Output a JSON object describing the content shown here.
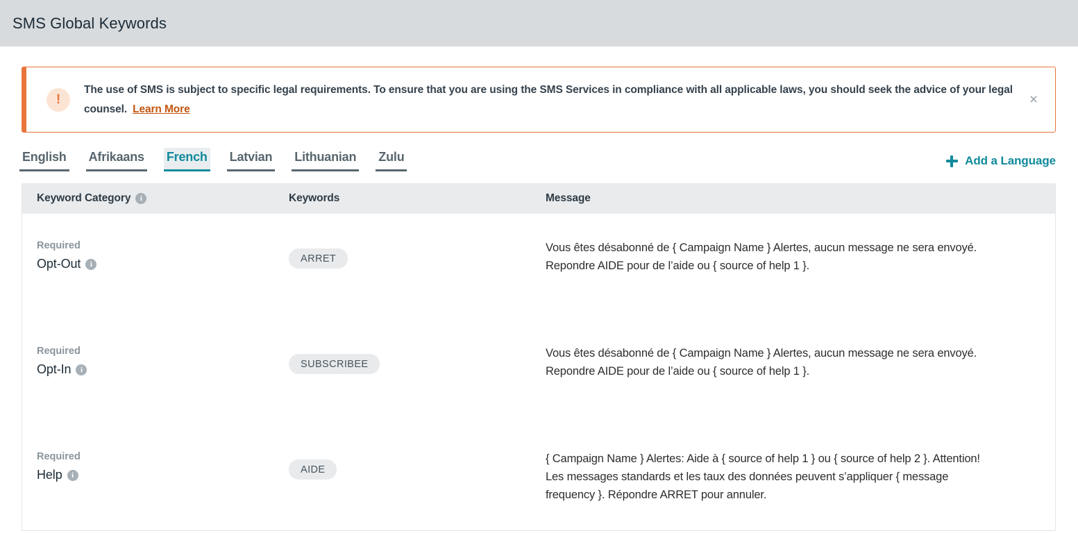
{
  "header": {
    "title": "SMS Global Keywords"
  },
  "alert": {
    "icon": "exclamation-icon",
    "icon_glyph": "!",
    "text": "The use of SMS is subject to specific legal requirements. To ensure that you are using the SMS Services in compliance with all applicable laws, you should seek the advice of your legal counsel.",
    "link_label": "Learn More",
    "close_glyph": "×",
    "accent_color": "#e8743b",
    "link_color": "#c35610"
  },
  "tabs": {
    "items": [
      {
        "label": "English",
        "active": false
      },
      {
        "label": "Afrikaans",
        "active": false
      },
      {
        "label": "French",
        "active": true
      },
      {
        "label": "Latvian",
        "active": false
      },
      {
        "label": "Lithuanian",
        "active": false
      },
      {
        "label": "Zulu",
        "active": false
      }
    ],
    "active_color": "#108a9c",
    "add_language_label": "Add a Language"
  },
  "table": {
    "columns": {
      "category": "Keyword Category",
      "keywords": "Keywords",
      "message": "Message"
    },
    "info_glyph": "i",
    "rows": [
      {
        "requirement": "Required",
        "category": "Opt-Out",
        "keyword": "ARRET",
        "message": "Vous êtes désabonné de { Campaign Name } Alertes, aucun message ne sera envoyé. Repondre AIDE pour de l’aide ou { source of help 1 }."
      },
      {
        "requirement": "Required",
        "category": "Opt-In",
        "keyword": "SUBSCRIBEE",
        "message": "Vous êtes désabonné de { Campaign Name } Alertes, aucun message ne sera envoyé. Repondre AIDE pour de l’aide ou { source of help 1 }."
      },
      {
        "requirement": "Required",
        "category": "Help",
        "keyword": "AIDE",
        "message": "{ Campaign Name } Alertes: Aide à { source of help 1 } ou { source of help 2 }. Attention! Les messages standards et les taux des données peuvent s’appliquer { message frequency }. Répondre ARRET pour annuler."
      }
    ]
  }
}
